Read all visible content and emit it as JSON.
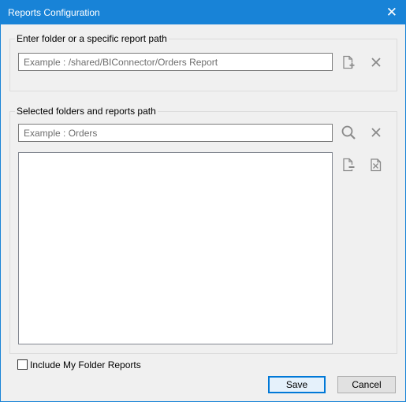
{
  "window": {
    "title": "Reports Configuration"
  },
  "path_group": {
    "legend": "Enter folder or a specific report path",
    "input_placeholder": "Example : /shared/BIConnector/Orders Report"
  },
  "selected_group": {
    "legend": "Selected folders and reports path",
    "filter_placeholder": "Example : Orders",
    "items": []
  },
  "options": {
    "include_my_folder_label": "Include My Folder Reports",
    "include_my_folder_checked": false
  },
  "buttons": {
    "save": "Save",
    "cancel": "Cancel"
  },
  "icons": {
    "close": "close-icon",
    "add_path": "add-document-icon",
    "clear_path": "clear-icon",
    "search": "search-icon",
    "clear_filter": "clear-icon",
    "remove_selected": "remove-document-icon",
    "remove_all": "remove-all-icon"
  },
  "colors": {
    "titlebar": "#1883d7",
    "accent": "#0078d7",
    "icon_gray": "#8a8a8a"
  }
}
